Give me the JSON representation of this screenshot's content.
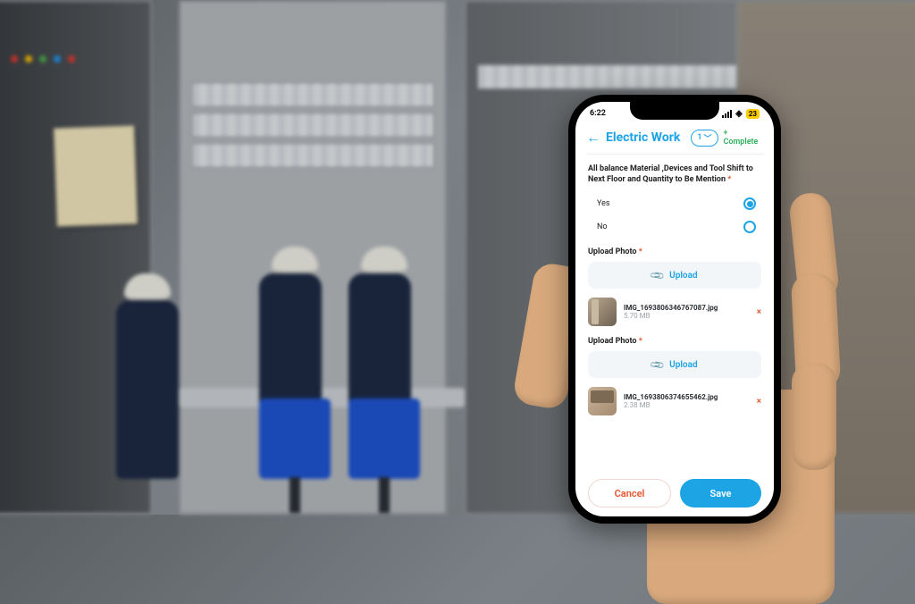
{
  "status_bar": {
    "time": "6:22",
    "battery_badge": "23"
  },
  "header": {
    "title": "Electric Work",
    "step_label": "1",
    "complete_label": "Complete"
  },
  "form": {
    "question_text": "All balance Material ,Devices and Tool Shift to Next Floor and Quantity to Be Mention",
    "required_mark": "*",
    "options": {
      "yes": "Yes",
      "no": "No"
    },
    "upload_sections": [
      {
        "label": "Upload Photo",
        "button": "Upload",
        "file": {
          "name": "IMG_1693806346767087.jpg",
          "size": "5.70 MB"
        }
      },
      {
        "label": "Upload Photo",
        "button": "Upload",
        "file": {
          "name": "IMG_1693806374655462.jpg",
          "size": "2.38 MB"
        }
      }
    ]
  },
  "buttons": {
    "cancel": "Cancel",
    "save": "Save"
  },
  "colors": {
    "accent": "#1ca4e5",
    "success": "#2eaf5c",
    "danger": "#e5542c"
  }
}
